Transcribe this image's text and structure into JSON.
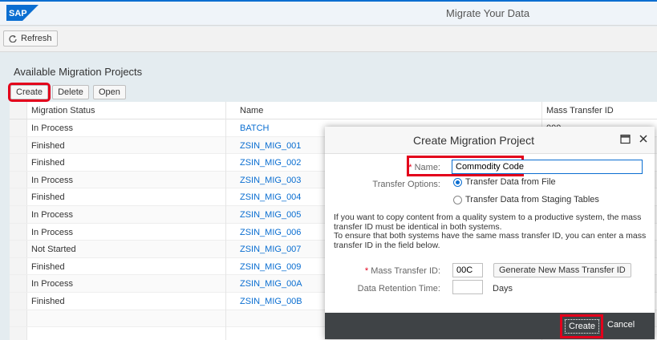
{
  "shell": {
    "logo": "SAP",
    "title": "Migrate Your Data"
  },
  "toolbar": {
    "refresh_label": "Refresh"
  },
  "section": {
    "title": "Available Migration Projects"
  },
  "table_toolbar": {
    "create": "Create",
    "delete": "Delete",
    "open": "Open"
  },
  "table": {
    "columns": [
      "Migration Status",
      "Name",
      "Mass Transfer ID"
    ],
    "rows": [
      {
        "status": "In Process",
        "name": "BATCH",
        "id": "000"
      },
      {
        "status": "Finished",
        "name": "ZSIN_MIG_001",
        "id": ""
      },
      {
        "status": "Finished",
        "name": "ZSIN_MIG_002",
        "id": ""
      },
      {
        "status": "In Process",
        "name": "ZSIN_MIG_003",
        "id": ""
      },
      {
        "status": "Finished",
        "name": "ZSIN_MIG_004",
        "id": ""
      },
      {
        "status": "In Process",
        "name": "ZSIN_MIG_005",
        "id": ""
      },
      {
        "status": "In Process",
        "name": "ZSIN_MIG_006",
        "id": ""
      },
      {
        "status": "Not Started",
        "name": "ZSIN_MIG_007",
        "id": ""
      },
      {
        "status": "Finished",
        "name": "ZSIN_MIG_009",
        "id": ""
      },
      {
        "status": "In Process",
        "name": "ZSIN_MIG_00A",
        "id": ""
      },
      {
        "status": "Finished",
        "name": "ZSIN_MIG_00B",
        "id": ""
      },
      {
        "status": "",
        "name": "",
        "id": ""
      },
      {
        "status": "",
        "name": "",
        "id": ""
      }
    ]
  },
  "dialog": {
    "title": "Create Migration Project",
    "name_label": "Name:",
    "name_value": "Commodity Code",
    "transfer_options_label": "Transfer Options:",
    "option_file": "Transfer Data from File",
    "option_staging": "Transfer Data from Staging Tables",
    "info_line1": "If you want to copy content from a quality system to a productive system, the mass transfer ID must be identical in both systems.",
    "info_line2": "To ensure that both systems have the same mass transfer ID, you can enter a mass transfer ID in the field below.",
    "mass_transfer_label": "Mass Transfer ID:",
    "mass_transfer_value": "00C",
    "generate_button": "Generate New Mass Transfer ID",
    "retention_label": "Data Retention Time:",
    "retention_value": "",
    "days_label": "Days",
    "create_button": "Create",
    "cancel_button": "Cancel"
  },
  "colors": {
    "accent": "#0a6ed1",
    "highlight": "#e3001b",
    "footer": "#3f4346"
  }
}
